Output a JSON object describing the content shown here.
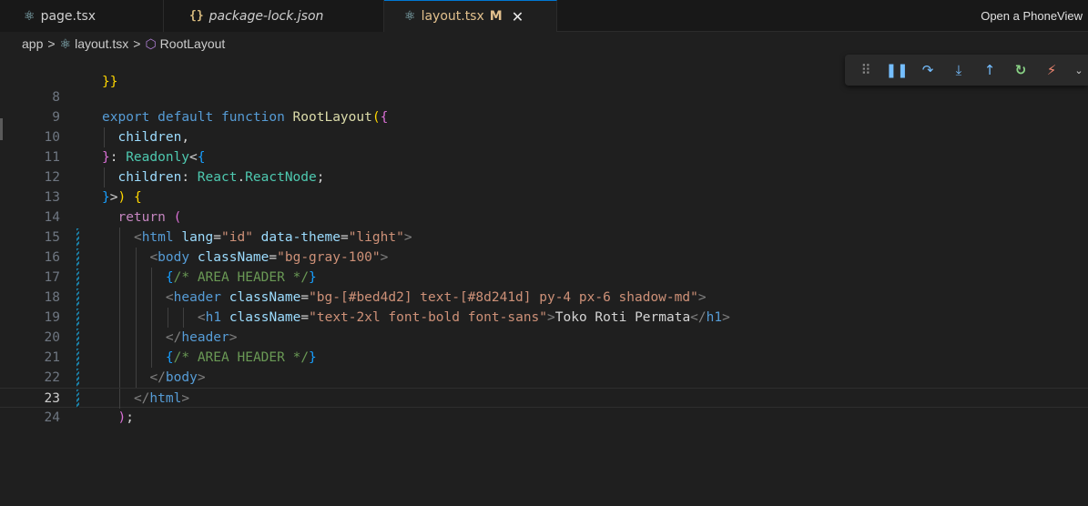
{
  "tabs": [
    {
      "label": "page.tsx",
      "icon": "react-icon"
    },
    {
      "label": "package-lock.json",
      "icon": "json-icon"
    },
    {
      "label": "layout.tsx",
      "icon": "react-icon",
      "modified": "M",
      "active": true
    }
  ],
  "phone_view_label": "Open a PhoneView",
  "breadcrumb": {
    "folder": "app",
    "file": "layout.tsx",
    "symbol": "RootLayout"
  },
  "debug_toolbar": [
    "grip-icon",
    "pause-icon",
    "step-over-icon",
    "step-into-icon",
    "step-out-icon",
    "restart-icon",
    "disconnect-icon",
    "chevron-down-icon"
  ],
  "editor": {
    "current_line": 23,
    "partial_top": "}}",
    "lines": [
      {
        "n": "8"
      },
      {
        "n": "9",
        "t": [
          "export",
          " ",
          "default",
          " ",
          "function",
          " ",
          "RootLayout",
          "(",
          "{"
        ]
      },
      {
        "n": "10",
        "t": [
          "children",
          ","
        ]
      },
      {
        "n": "11",
        "t": [
          "}",
          ": ",
          "Readonly",
          "<",
          "{"
        ]
      },
      {
        "n": "12",
        "t": [
          "children",
          ": ",
          "React",
          ".",
          "ReactNode",
          ";"
        ]
      },
      {
        "n": "13",
        "t": [
          "}",
          ">",
          ")",
          " ",
          "{"
        ]
      },
      {
        "n": "14",
        "t": [
          "return",
          " ",
          "("
        ]
      },
      {
        "n": "15",
        "t": [
          "<",
          "html",
          " ",
          "lang",
          "=",
          "\"id\"",
          " ",
          "data-theme",
          "=",
          "\"light\"",
          ">"
        ]
      },
      {
        "n": "16",
        "t": [
          "<",
          "body",
          " ",
          "className",
          "=",
          "\"bg-gray-100\"",
          ">"
        ]
      },
      {
        "n": "17",
        "t": [
          "{",
          "/* AREA HEADER */",
          "}"
        ]
      },
      {
        "n": "18",
        "t": [
          "<",
          "header",
          " ",
          "className",
          "=",
          "\"bg-[#bed4d2] text-[#8d241d] py-4 px-6 shadow-md\"",
          ">"
        ]
      },
      {
        "n": "19",
        "t": [
          "<",
          "h1",
          " ",
          "className",
          "=",
          "\"text-2xl font-bold font-sans\"",
          ">",
          "Toko Roti Permata",
          "</",
          "h1",
          ">"
        ]
      },
      {
        "n": "20",
        "t": [
          "</",
          "header",
          ">"
        ]
      },
      {
        "n": "21",
        "t": [
          "{",
          "/* AREA HEADER */",
          "}"
        ]
      },
      {
        "n": "22",
        "t": [
          "</",
          "body",
          ">"
        ]
      },
      {
        "n": "23",
        "t": [
          "</",
          "html",
          ">"
        ]
      },
      {
        "n": "24",
        "t": [
          ")",
          ";"
        ]
      }
    ]
  },
  "colors": {
    "accent": "#0078d4",
    "modified": "#e2c08d",
    "background": "#1f1f1f"
  }
}
